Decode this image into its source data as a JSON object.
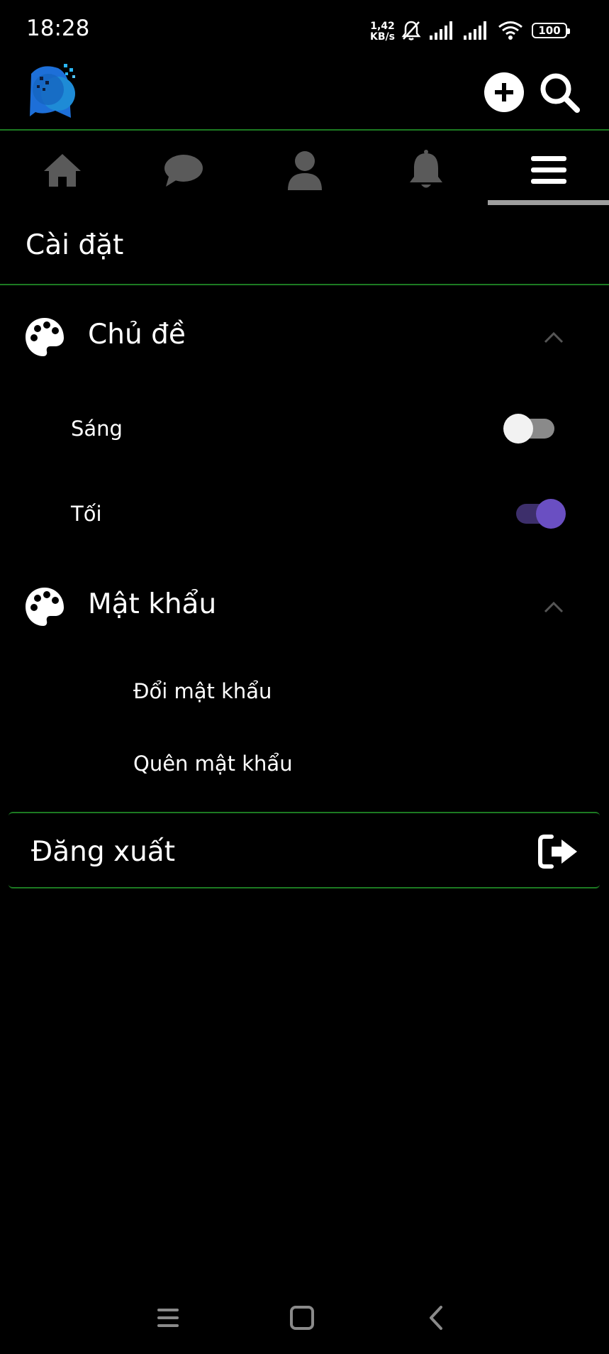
{
  "status_bar": {
    "time": "18:28",
    "net_speed_value": "1,42",
    "net_speed_unit": "KB/s",
    "battery": "100",
    "icons": [
      "mute-icon",
      "signal-icon",
      "signal-icon",
      "wifi-icon",
      "battery-icon"
    ]
  },
  "header": {
    "logo_icon": "app-logo",
    "add_icon": "plus-circle-icon",
    "search_icon": "search-icon"
  },
  "nav": {
    "tabs": [
      {
        "icon": "home-icon",
        "active": false
      },
      {
        "icon": "chat-icon",
        "active": false
      },
      {
        "icon": "user-icon",
        "active": false
      },
      {
        "icon": "bell-icon",
        "active": false
      },
      {
        "icon": "menu-icon",
        "active": true
      }
    ]
  },
  "settings": {
    "title": "Cài đặt",
    "theme_section": {
      "title": "Chủ đề",
      "options": [
        {
          "label": "Sáng",
          "enabled": false
        },
        {
          "label": "Tối",
          "enabled": true
        }
      ]
    },
    "password_section": {
      "title": "Mật khẩu",
      "links": [
        "Đổi mật khẩu",
        "Quên mật khẩu"
      ]
    },
    "logout": {
      "label": "Đăng xuất"
    }
  },
  "colors": {
    "background": "#000000",
    "divider": "#1c7a22",
    "accent": "#6a4fc2",
    "accent_track": "#3d2f6b",
    "inactive_icon": "#5a5a5a"
  }
}
